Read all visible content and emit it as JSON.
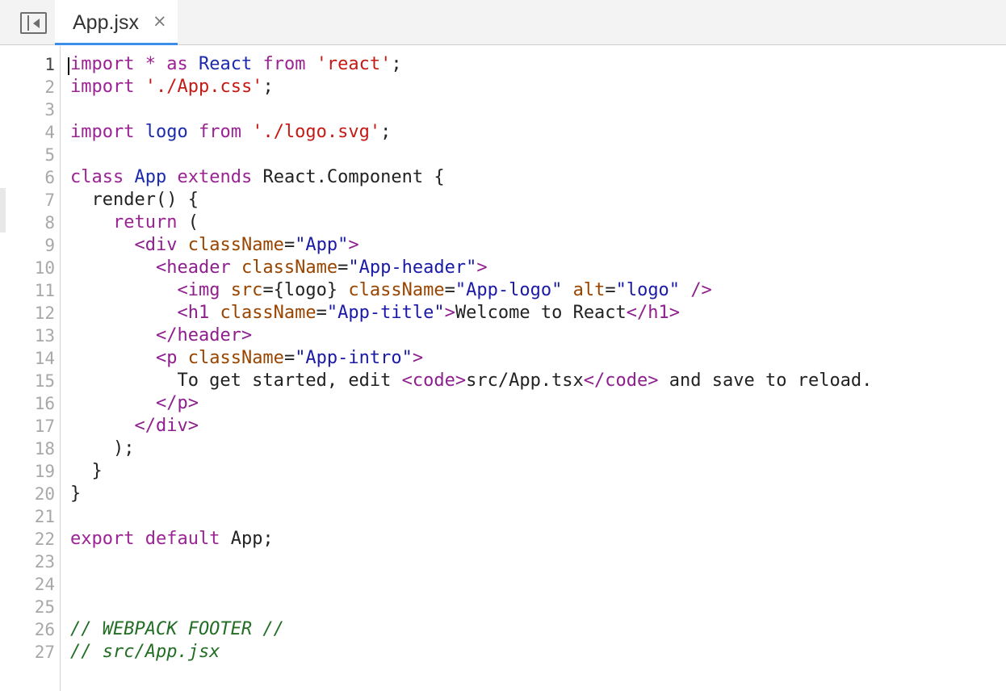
{
  "tab": {
    "label": "App.jsx",
    "close": "×"
  },
  "icons": {
    "panel_toggle": "sidebar-toggle-icon",
    "close": "close-icon"
  },
  "line_numbers": [
    "1",
    "2",
    "3",
    "4",
    "5",
    "6",
    "7",
    "8",
    "9",
    "10",
    "11",
    "12",
    "13",
    "14",
    "15",
    "16",
    "17",
    "18",
    "19",
    "20",
    "21",
    "22",
    "23",
    "24",
    "25",
    "26",
    "27"
  ],
  "code": {
    "l1": [
      "import",
      " ",
      "*",
      " as ",
      "React",
      " ",
      "from",
      " ",
      "'react'",
      ";"
    ],
    "l2": [
      "import",
      " ",
      "'./App.css'",
      ";"
    ],
    "l4": [
      "import",
      " ",
      "logo",
      " ",
      "from",
      " ",
      "'./logo.svg'",
      ";"
    ],
    "l6": [
      "class",
      " ",
      "App",
      " ",
      "extends",
      " React.Component {"
    ],
    "l7": [
      "  render() {"
    ],
    "l8": [
      "    ",
      "return",
      " ("
    ],
    "l9": [
      "      ",
      "<div",
      " ",
      "className",
      "=",
      "\"App\"",
      ">"
    ],
    "l10": [
      "        ",
      "<header",
      " ",
      "className",
      "=",
      "\"App-header\"",
      ">"
    ],
    "l11": [
      "          ",
      "<img",
      " ",
      "src",
      "={logo} ",
      "className",
      "=",
      "\"App-logo\"",
      " ",
      "alt",
      "=",
      "\"logo\"",
      " ",
      "/>"
    ],
    "l12": [
      "          ",
      "<h1",
      " ",
      "className",
      "=",
      "\"App-title\"",
      ">",
      "Welcome to React",
      "</h1>"
    ],
    "l13": [
      "        ",
      "</header>"
    ],
    "l14": [
      "        ",
      "<p",
      " ",
      "className",
      "=",
      "\"App-intro\"",
      ">"
    ],
    "l15": [
      "          To get started, edit ",
      "<code>",
      "src/App.tsx",
      "</code>",
      " and save to reload."
    ],
    "l16": [
      "        ",
      "</p>"
    ],
    "l17": [
      "      ",
      "</div>"
    ],
    "l18": [
      "    );"
    ],
    "l19": [
      "  }"
    ],
    "l20": [
      "}"
    ],
    "l22": [
      "export",
      " ",
      "default",
      " App;"
    ],
    "l26": [
      "// WEBPACK FOOTER //"
    ],
    "l27": [
      "// src/App.jsx"
    ]
  },
  "colors": {
    "keyword": "#9b2393",
    "definition": "#1c2bab",
    "string": "#c41a16",
    "tag": "#8e208e",
    "attribute": "#994500",
    "attribute_value": "#1a1aa6",
    "comment": "#236e25",
    "tab_underline": "#3b8eea"
  }
}
